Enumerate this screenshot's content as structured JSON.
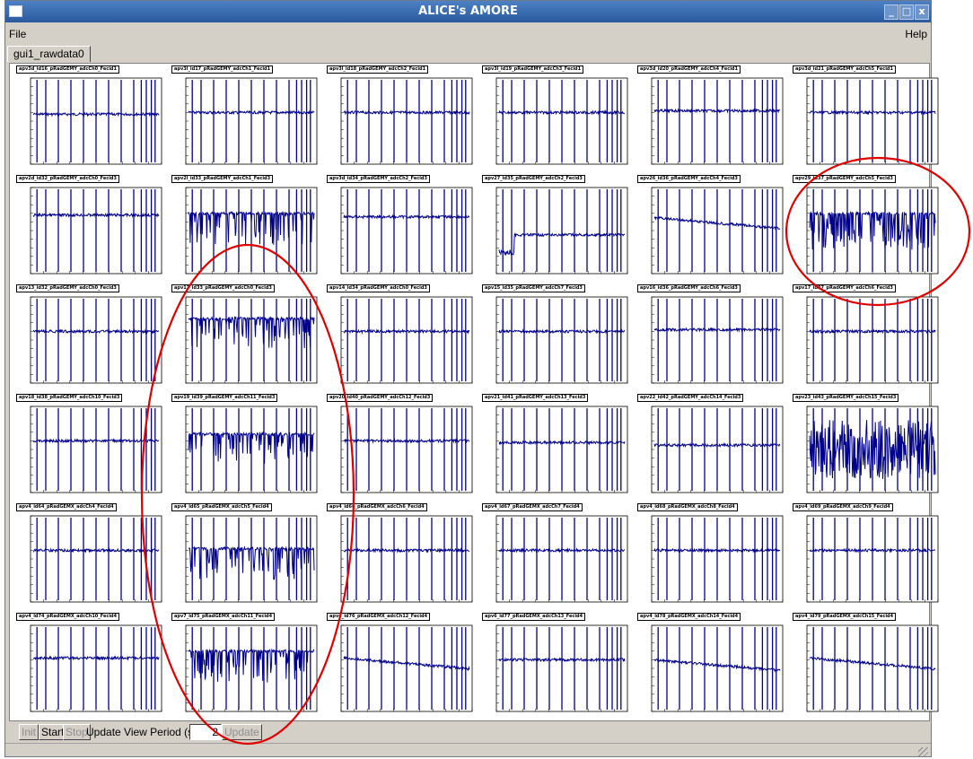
{
  "window": {
    "title": "ALICE's AMORE"
  },
  "menubar": {
    "file": "File",
    "help": "Help"
  },
  "tabs": [
    {
      "label": "gui1_rawdata0"
    }
  ],
  "toolbar": {
    "init": "Init",
    "start": "Start",
    "stop": "Stop",
    "period_label": "Update View Period (sec)",
    "period_value": "2",
    "update": "Update"
  },
  "colors": {
    "trace": "#00008b",
    "highlight": "#e00000",
    "titlebar": "#3a6ab0"
  },
  "plots": [
    {
      "title": "apv3d_id16_pRadGEMY_adcCh0_Fecid1",
      "style": "flat",
      "level": 0.58
    },
    {
      "title": "apv3l_id17_pRadGEMY_adcCh1_Fecid1",
      "style": "flat",
      "level": 0.6
    },
    {
      "title": "apv3l_id18_pRadGEMY_adcCh2_Fecid1",
      "style": "flat",
      "level": 0.6
    },
    {
      "title": "apv3l_id19_pRadGEMY_adcCh3_Fecid1",
      "style": "flat",
      "level": 0.6
    },
    {
      "title": "apv3d_id20_pRadGEMY_adcCh4_Fecid1",
      "style": "flat",
      "level": 0.62
    },
    {
      "title": "apv3d_id21_pRadGEMY_adcCh5_Fecid1",
      "style": "flat",
      "level": 0.6
    },
    {
      "title": "apv2d_id32_pRadGEMY_adcCh0_Fecid3",
      "style": "flat",
      "level": 0.68
    },
    {
      "title": "apv2l_id33_pRadGEMY_adcCh1_Fecid3",
      "style": "spiky",
      "level": 0.7
    },
    {
      "title": "apv3d_id34_pRadGEMY_adcCh2_Fecid3",
      "style": "flat",
      "level": 0.66
    },
    {
      "title": "apv27_id35_pRadGEMY_adcCh2_Fecid3",
      "style": "step",
      "level": 0.45
    },
    {
      "title": "apv26_id36_pRadGEMY_adcCh4_Fecid3",
      "style": "slope",
      "level": 0.65
    },
    {
      "title": "apv29_id37_pRadGEMY_adcCh5_Fecid3",
      "style": "dense",
      "level": 0.7
    },
    {
      "title": "apv13_id32_pRadGEMY_adcCh0_Fecid3",
      "style": "flat",
      "level": 0.6
    },
    {
      "title": "apv13_id33_pRadGEMY_adcCh0_Fecid3",
      "style": "spiky",
      "level": 0.75
    },
    {
      "title": "apv14_id34_pRadGEMY_adcCh0_Fecid3",
      "style": "flat",
      "level": 0.6
    },
    {
      "title": "apv15_id35_pRadGEMY_adcCh7_Fecid3",
      "style": "flat",
      "level": 0.6
    },
    {
      "title": "apv16_id36_pRadGEMY_adcCh6_Fecid3",
      "style": "flat",
      "level": 0.62
    },
    {
      "title": "apv17_id37_pRadGEMY_adcCh6_Fecid3",
      "style": "flat",
      "level": 0.6
    },
    {
      "title": "apv18_id38_pRadGEMY_adcCh10_Fecid3",
      "style": "flat",
      "level": 0.6
    },
    {
      "title": "apv19_id39_pRadGEMY_adcCh11_Fecid3",
      "style": "spiky",
      "level": 0.68
    },
    {
      "title": "apv20_id40_pRadGEMY_adcCh12_Fecid3",
      "style": "flat",
      "level": 0.6
    },
    {
      "title": "apv21_id41_pRadGEMY_adcCh13_Fecid3",
      "style": "flat",
      "level": 0.58
    },
    {
      "title": "apv22_id42_pRadGEMY_adcCh14_Fecid3",
      "style": "flat",
      "level": 0.55
    },
    {
      "title": "apv23_id43_pRadGEMY_adcCh15_Fecid3",
      "style": "noise",
      "level": 0.5
    },
    {
      "title": "apv4_id64_pRadGEMX_adcCh4_Fecid4",
      "style": "flat",
      "level": 0.6
    },
    {
      "title": "apv4_id65_pRadGEMX_adcCh5_Fecid4",
      "style": "spiky",
      "level": 0.62
    },
    {
      "title": "apv4_id66_pRadGEMX_adcCh6_Fecid4",
      "style": "flat",
      "level": 0.6
    },
    {
      "title": "apv4_id67_pRadGEMX_adcCh7_Fecid4",
      "style": "flat",
      "level": 0.6
    },
    {
      "title": "apv4_id68_pRadGEMX_adcCh8_Fecid4",
      "style": "flat",
      "level": 0.6
    },
    {
      "title": "apv4_id69_pRadGEMX_adcCh9_Fecid4",
      "style": "flat",
      "level": 0.6
    },
    {
      "title": "apv4_id74_pRadGEMX_adcCh10_Fecid4",
      "style": "flat",
      "level": 0.62
    },
    {
      "title": "apv7_id75_pRadGEMX_adcCh11_Fecid4",
      "style": "spiky",
      "level": 0.7
    },
    {
      "title": "apv4_id76_pRadGEMX_adcCh12_Fecid4",
      "style": "slope",
      "level": 0.62
    },
    {
      "title": "apv6_id77_pRadGEMX_adcCh13_Fecid4",
      "style": "flat",
      "level": 0.6
    },
    {
      "title": "apv4_id78_pRadGEMX_adcCh14_Fecid4",
      "style": "slope",
      "level": 0.6
    },
    {
      "title": "apv4_id79_pRadGEMX_adcCh15_Fecid4",
      "style": "slope",
      "level": 0.62
    }
  ]
}
